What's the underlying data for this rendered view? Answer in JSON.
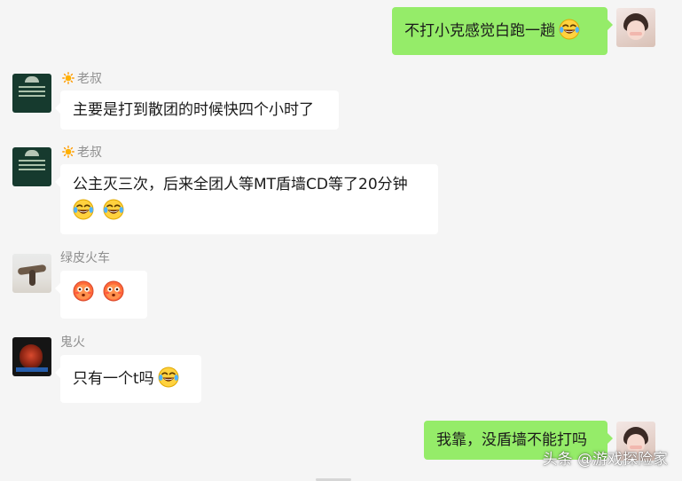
{
  "messages": [
    {
      "sender": "me",
      "text": "不打小克感觉白跑一趟",
      "emojis": [
        "laugh-cry-emoji"
      ]
    },
    {
      "sender": "老叔",
      "text": "主要是打到散团的时候快四个小时了",
      "emojis": []
    },
    {
      "sender": "老叔",
      "text": "公主灭三次，后来全团人等MT盾墙CD等了20分钟",
      "emojis": [
        "laugh-cry-emoji",
        "laugh-cry-emoji"
      ]
    },
    {
      "sender": "绿皮火车",
      "text": "",
      "emojis": [
        "flushed-emoji",
        "flushed-emoji"
      ]
    },
    {
      "sender": "鬼火",
      "text": "只有一个t吗",
      "emojis": [
        "laugh-cry-emoji"
      ]
    },
    {
      "sender": "me",
      "text": "我靠，没盾墙不能打吗",
      "emojis": []
    }
  ],
  "watermark": "头条 @游戏探险家",
  "colors": {
    "background": "#f5f5f5",
    "my_bubble": "#95ec69",
    "other_bubble": "#ffffff",
    "name_text": "#8f8f8f"
  }
}
